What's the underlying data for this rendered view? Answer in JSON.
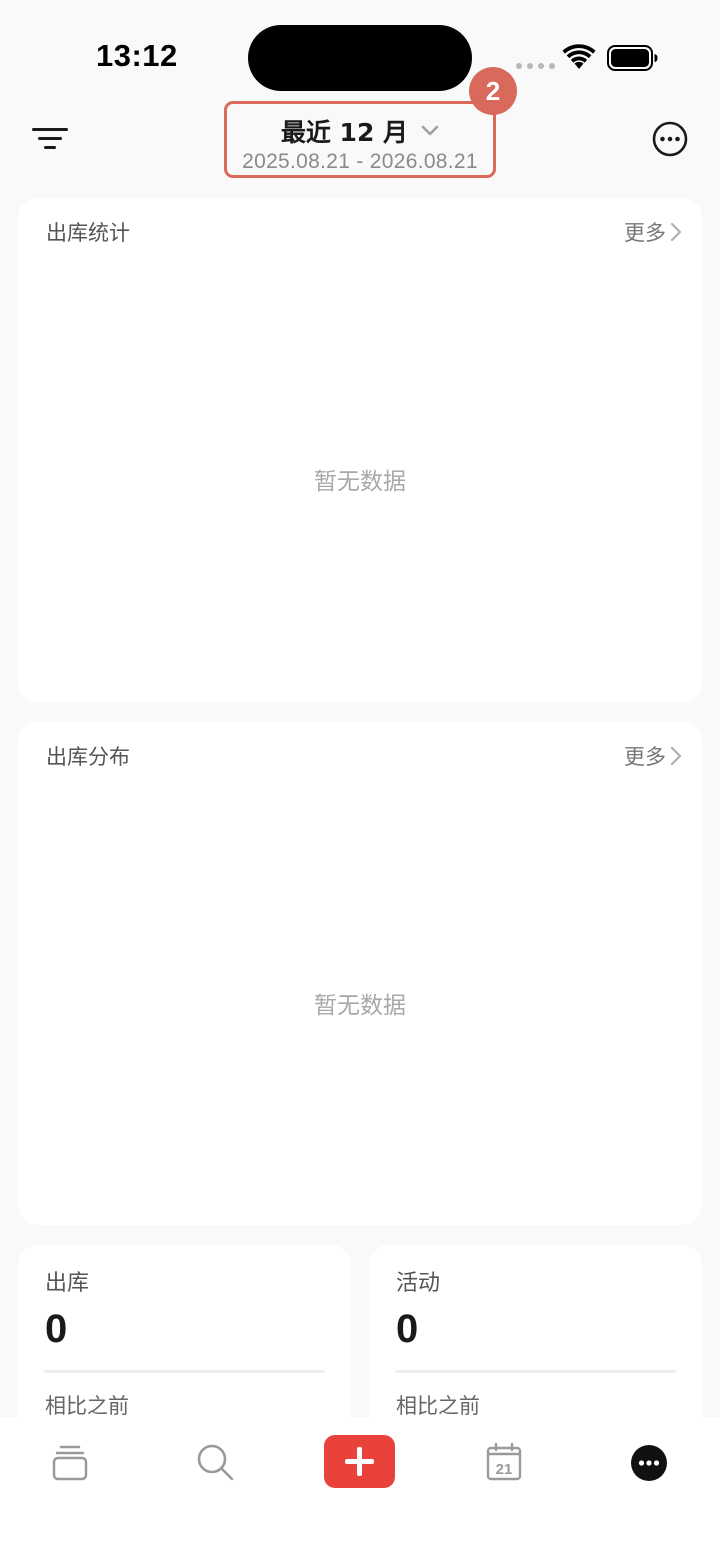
{
  "status_bar": {
    "time": "13:12"
  },
  "header": {
    "range_title": "最近 12 月",
    "range_dates": "2025.08.21 - 2026.08.21",
    "badge": "2",
    "accent_color": "#d9695a"
  },
  "cards": {
    "outbound_stats": {
      "title": "出库统计",
      "more": "更多",
      "empty": "暂无数据"
    },
    "outbound_distribution": {
      "title": "出库分布",
      "more": "更多",
      "empty": "暂无数据"
    },
    "stats": [
      {
        "label": "出库",
        "value": "0",
        "compare": "相比之前"
      },
      {
        "label": "活动",
        "value": "0",
        "compare": "相比之前"
      }
    ]
  },
  "tab_bar": {
    "tabs": [
      {
        "icon": "stack-icon"
      },
      {
        "icon": "search-icon"
      },
      {
        "icon": "add-icon",
        "color": "#e8423a"
      },
      {
        "icon": "calendar-icon",
        "calendar_day": "21"
      },
      {
        "icon": "more-icon"
      }
    ]
  }
}
